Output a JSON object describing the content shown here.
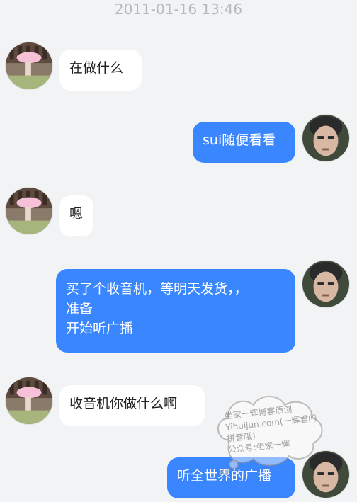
{
  "timestamp": "2011-01-16 13:46",
  "messages": [
    {
      "side": "left",
      "text": "在做什么",
      "avatar": "avatar-girl"
    },
    {
      "side": "right",
      "text": "sui随便看看",
      "avatar": "avatar-boy"
    },
    {
      "side": "left",
      "text": "嗯",
      "avatar": "avatar-girl"
    },
    {
      "side": "right",
      "lines": [
        "买了个收音机，等明天发货，，",
        "准备",
        "开始听广播"
      ],
      "avatar": "avatar-boy"
    },
    {
      "side": "left",
      "text": "收音机你做什么啊",
      "avatar": "avatar-girl"
    },
    {
      "side": "right",
      "text": "听全世界的广播",
      "avatar": "avatar-boy"
    }
  ],
  "watermark": {
    "line1": "坐家一辉博客原创",
    "line2": "Yihuijun.com(一辉君的",
    "line3": "拼音哦)",
    "line4": "公众号:坐家一辉"
  },
  "colors": {
    "background": "#f2f3f5",
    "right_bubble": "#3a86ff",
    "left_bubble": "#ffffff"
  }
}
